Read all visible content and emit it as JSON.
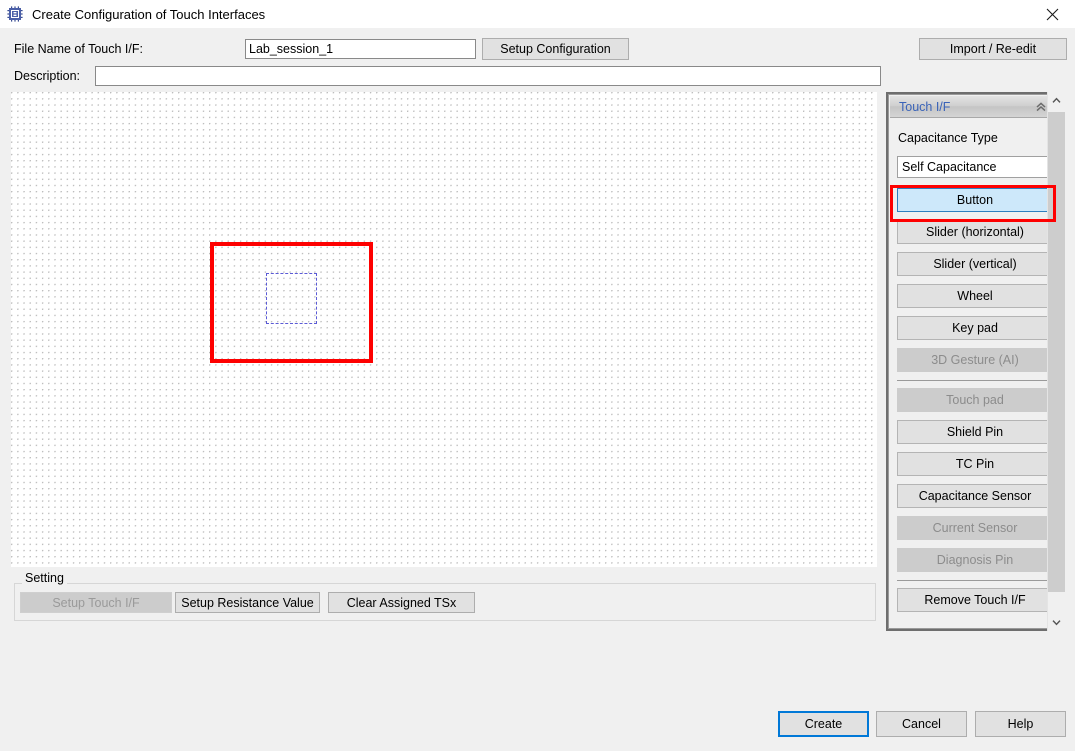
{
  "window": {
    "title": "Create Configuration of Touch Interfaces",
    "app_icon": "chip-icon",
    "close_icon": "close-icon"
  },
  "form": {
    "filename_label": "File Name of Touch I/F:",
    "filename_value": "Lab_session_1",
    "filename_placeholder": "",
    "description_label": "Description:",
    "description_value": "",
    "description_placeholder": "",
    "setup_configuration_label": "Setup Configuration",
    "import_reedit_label": "Import / Re-edit"
  },
  "canvas": {
    "selection_box_color": "#fe0000",
    "widget_outline_color": "#5b5bd6",
    "grid_dot_color": "#bdbdbd"
  },
  "setting": {
    "legend": "Setting",
    "buttons": [
      {
        "label": "Setup Touch I/F",
        "enabled": false
      },
      {
        "label": "Setup Resistance Value",
        "enabled": true
      },
      {
        "label": "Clear Assigned TSx",
        "enabled": true
      }
    ]
  },
  "tool_panel": {
    "header_title": "Touch I/F",
    "header_title_color": "#3a63b8",
    "collapse_icon": "chevron-double-up-icon",
    "capacitance_type_label": "Capacitance Type",
    "capacitance_select_value": "Self Capacitance",
    "capacitance_select_arrow_icon": "chevron-down-icon",
    "highlight_color": "#fe0000",
    "selected_bg": "#cde8fa",
    "items": [
      {
        "label": "Button",
        "enabled": true,
        "selected": true,
        "highlighted": true,
        "separator_after": false
      },
      {
        "label": "Slider (horizontal)",
        "enabled": true,
        "selected": false,
        "highlighted": false,
        "separator_after": false
      },
      {
        "label": "Slider (vertical)",
        "enabled": true,
        "selected": false,
        "highlighted": false,
        "separator_after": false
      },
      {
        "label": "Wheel",
        "enabled": true,
        "selected": false,
        "highlighted": false,
        "separator_after": false
      },
      {
        "label": "Key pad",
        "enabled": true,
        "selected": false,
        "highlighted": false,
        "separator_after": false
      },
      {
        "label": "3D Gesture (AI)",
        "enabled": false,
        "selected": false,
        "highlighted": false,
        "separator_after": true
      },
      {
        "label": "Touch pad",
        "enabled": false,
        "selected": false,
        "highlighted": false,
        "separator_after": false
      },
      {
        "label": "Shield Pin",
        "enabled": true,
        "selected": false,
        "highlighted": false,
        "separator_after": false
      },
      {
        "label": "TC Pin",
        "enabled": true,
        "selected": false,
        "highlighted": false,
        "separator_after": false
      },
      {
        "label": "Capacitance Sensor",
        "enabled": true,
        "selected": false,
        "highlighted": false,
        "separator_after": false
      },
      {
        "label": "Current Sensor",
        "enabled": false,
        "selected": false,
        "highlighted": false,
        "separator_after": false
      },
      {
        "label": "Diagnosis Pin",
        "enabled": false,
        "selected": false,
        "highlighted": false,
        "separator_after": true
      },
      {
        "label": "Remove Touch I/F",
        "enabled": true,
        "selected": false,
        "highlighted": false,
        "separator_after": false
      }
    ]
  },
  "scrollbar": {
    "up_icon": "chevron-up-icon",
    "down_icon": "chevron-down-icon"
  },
  "footer": {
    "create_label": "Create",
    "cancel_label": "Cancel",
    "help_label": "Help",
    "focus_color": "#0078d7"
  }
}
